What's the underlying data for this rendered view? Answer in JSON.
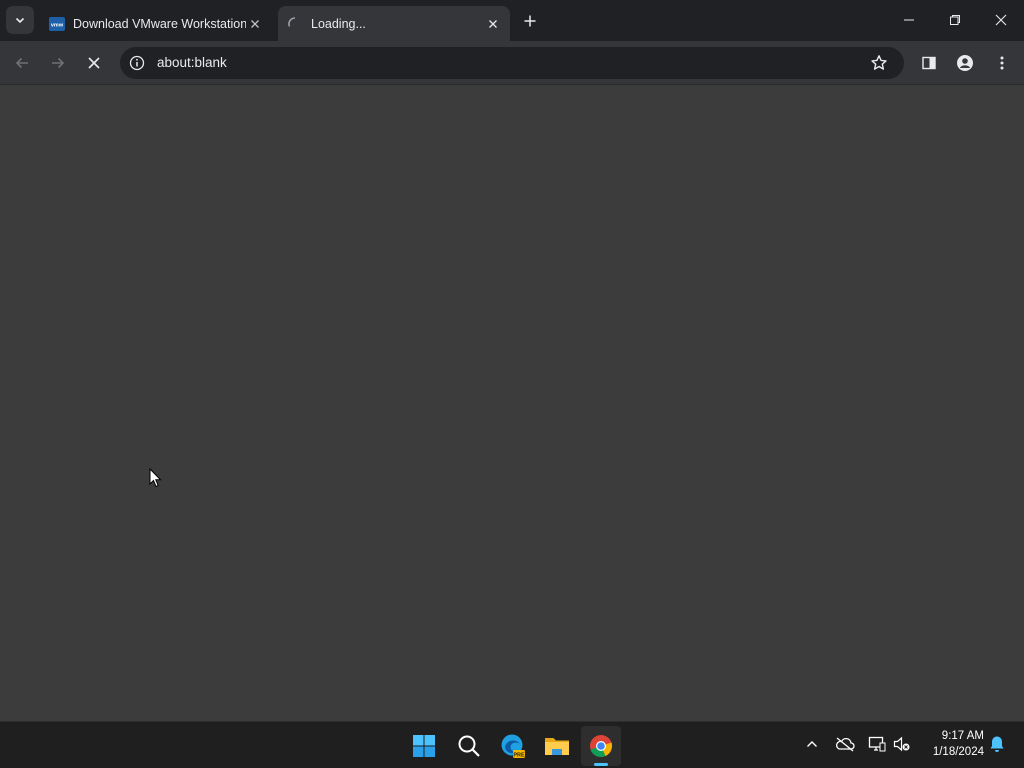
{
  "browser": {
    "tabs": [
      {
        "title": "Download VMware Workstation",
        "favicon_text": "vmw",
        "active": false
      },
      {
        "title": "Loading...",
        "active": true
      }
    ],
    "address": "about:blank"
  },
  "taskbar": {
    "time": "9:17 AM",
    "date": "1/18/2024",
    "apps": [
      "start-icon",
      "search-icon",
      "edge-preview-icon",
      "file-explorer-icon",
      "chrome-icon"
    ]
  },
  "colors": {
    "tabstrip": "#202124",
    "toolbar": "#35363a",
    "content": "#3c3c3c",
    "taskbar": "#1f1f1f",
    "accent": "#4cc2ff"
  }
}
